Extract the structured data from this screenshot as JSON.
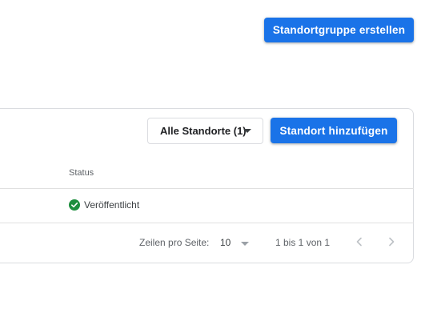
{
  "header": {
    "create_group_label": "Standortgruppe erstellen"
  },
  "card": {
    "filter": {
      "selected": "Alle Standorte (1)"
    },
    "add_location_label": "Standort hinzufügen",
    "table": {
      "columns": [
        "Status"
      ],
      "rows": [
        {
          "status": "Veröffentlicht",
          "status_icon": "check-circle-icon"
        }
      ]
    },
    "pagination": {
      "rows_per_page_label": "Zeilen pro Seite:",
      "rows_per_page_value": "10",
      "range_text": "1 bis 1 von 1",
      "prev_icon": "chevron-left-icon",
      "next_icon": "chevron-right-icon"
    }
  },
  "colors": {
    "primary": "#1a73e8",
    "success": "#1e8e3e",
    "border": "#dadce0",
    "disabled_icon": "#bdc1c6"
  }
}
